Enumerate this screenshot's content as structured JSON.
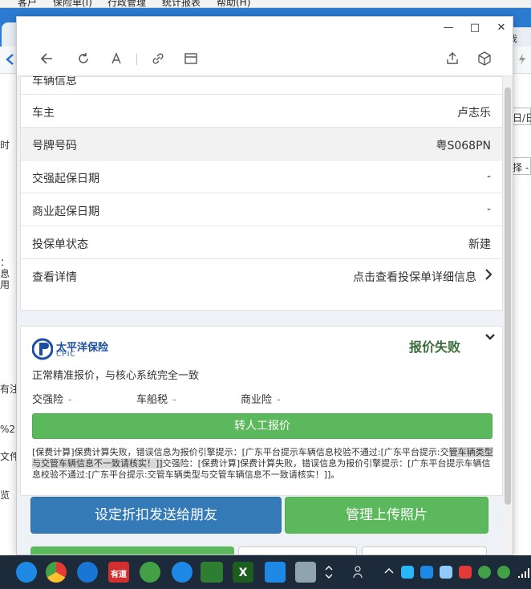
{
  "background_app": {
    "menu": [
      "客户",
      "保险单(I)",
      "行政管理",
      "统计报表",
      "帮助(H)"
    ],
    "right_tab_label": "我",
    "left_fragments": [
      "时",
      "：",
      "息",
      "用",
      "有注",
      "%2",
      "文件",
      "览"
    ],
    "right_fragments": [
      "日/日",
      "择 -"
    ]
  },
  "window": {
    "minimize": "—",
    "maximize": "□",
    "close": "✕"
  },
  "toolbar_icons": [
    "back-icon",
    "refresh-icon",
    "font-icon",
    "link-icon",
    "window-icon",
    "share-icon",
    "cube-icon"
  ],
  "vehicle_info": {
    "section_title": "车辆信息",
    "rows": [
      {
        "label": "车主",
        "value": "卢志乐"
      },
      {
        "label": "号牌号码",
        "value": "粤S068PN"
      },
      {
        "label": "交强起保日期",
        "value": "-"
      },
      {
        "label": "商业起保日期",
        "value": "-"
      },
      {
        "label": "投保单状态",
        "value": "新建"
      },
      {
        "label": "查看详情",
        "value": "点击查看投保单详细信息"
      }
    ]
  },
  "quote": {
    "company_name": "太平洋保险",
    "company_sub": "CPIC",
    "status": "报价失败",
    "description": "正常精准报价，与核心系统完全一致",
    "fees": [
      {
        "label": "交强险",
        "value": "-"
      },
      {
        "label": "车船税",
        "value": "-"
      },
      {
        "label": "商业险",
        "value": "-"
      }
    ],
    "manual_button": "转人工报价",
    "error_part1": "[保费计算]保费计算失败，错误信息为报价引擎提示：[广东平台提示车辆信息校验不通过:[广东平台提示:交",
    "error_highlight": "管车辆类型与交管车辆信息不一致请核实！]]",
    "error_part2": "交强险：[保费计算]保费计算失败，错误信息为报价引擎提示：[广东平台提示车辆信息校验不通过:[广东平台提示:交管车辆类型与交管车辆信息不一致请核实！]]。"
  },
  "actions": {
    "discount_button": "设定折扣发送给朋友",
    "upload_button": "管理上传照片"
  },
  "taskbar": {
    "youdao_label": "有道",
    "excel_label": "X"
  },
  "colors": {
    "primary_blue": "#337ab7",
    "success_green": "#5cb85c",
    "status_fail": "#3a6b3a",
    "brand_blue": "#1d4fa0",
    "taskbar": "#1d2a3a"
  }
}
